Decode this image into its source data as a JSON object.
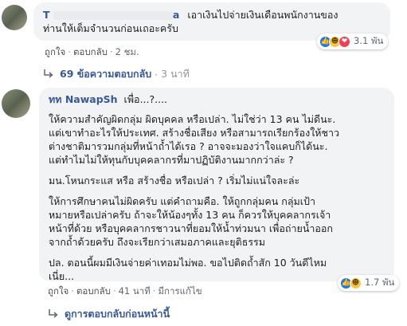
{
  "comment1": {
    "name": "T",
    "name_tail": "a",
    "text_line1": "เอาเงินไปจ่ายเงินเดือนพนักงานของ",
    "text_line2": "ท่านให้เต็มจำนวนก่อนเถอะครับ",
    "actions": {
      "like": "ถูกใจ",
      "reply": "ตอบกลับ",
      "time": "2 ชม."
    },
    "reactions": {
      "count": "3.1 พัน",
      "icons": [
        "like-icon",
        "haha-icon",
        "love-icon"
      ]
    }
  },
  "replies_link": {
    "label": "69 ข้อความตอบกลับ",
    "time": "3 นาที"
  },
  "comment2": {
    "name": "ทท NawapSh",
    "name_suffix": "เพื่อ...?....",
    "paragraphs": [
      {
        "lines": [
          "ให้ความสำคัญผิดกลุ่ม ผิดบุคคล หรือเปล่า. ไม่ใช่ว่า 13 คน ไม่ดีนะ.",
          "แต่เขาทำอะไรให้ประเทศ. สร้างชื่อเสียง หรือสามารถเรียกร้องให้ชาว",
          "ต่างชาติมารวมกลุ่มที่หน้าถ้ำได้เรอ ? อาจจะมองว่าใจแคบก็ได้นะ.",
          "แต่ทำไมไม่ให้ทุนกับบุคคลากรที่มาปฏิบัติงานมากกว่าล่ะ ?"
        ]
      },
      {
        "lines": [
          "มน.โหนกระแส หรือ สร้างชื่อ หรือเปล่า ? เริ่มไม่แน่ใจละล่ะ"
        ]
      },
      {
        "lines": [
          "ให้การศึกษาคนไม่ผิดครับ แต่คำถามคือ. ให้ถูกกลุ่มคน กลุ่มเป้า",
          "หมายหรือเปล่าครับ ถ้าจะให้น้องๆทั้ง 13 คน ก็ควรให้บุคคลากรเจ้า",
          "หน้าที่ด้วย หรือบุคคลากรชาวนาที่ยอมให้น้ำท่วมนา เพื่อถ่ายน้ำออก",
          "จากถ้ำด้วยครับ ถึงจะเรียกว่าเสมอภาคและยุติธรรม"
        ]
      },
      {
        "lines": [
          "ปล. ตอนนี้ผมมีเงินจ่ายค่าเทอมไม่พอ. ขอไปติดถ้ำสัก 10 วันดีไหม",
          "เนี่ย..."
        ]
      }
    ],
    "actions": {
      "like": "ถูกใจ",
      "reply": "ตอบกลับ",
      "time": "41 นาที",
      "edited": "มีการแก้ไข"
    },
    "reactions": {
      "count": "1.7 พัน",
      "icons": [
        "like-icon",
        "haha-icon"
      ]
    }
  },
  "more_link": {
    "label": "ดูการตอบกลับก่อนหน้านี้"
  },
  "colors": {
    "link": "#385898",
    "bubble": "#f2f3f5",
    "like": "#1877f2",
    "love": "#f33e58",
    "haha": "#f7c744"
  }
}
